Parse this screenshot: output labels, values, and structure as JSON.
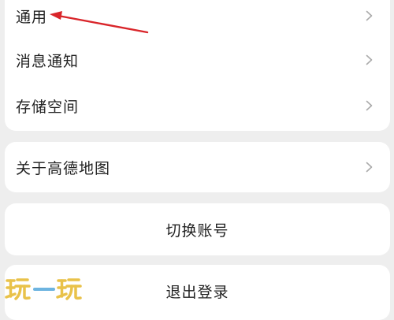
{
  "settings_group_1": {
    "items": [
      {
        "label": "通用"
      },
      {
        "label": "消息通知"
      },
      {
        "label": "存储空间"
      }
    ]
  },
  "settings_group_2": {
    "items": [
      {
        "label": "关于高德地图"
      }
    ]
  },
  "actions": {
    "switch_account": "切换账号",
    "logout": "退出登录"
  },
  "annotation": {
    "arrow_color": "#d9252a"
  },
  "watermark": {
    "text": "玩一玩",
    "colors": [
      "#e9c24a",
      "#6db4e0"
    ]
  },
  "icons": {
    "row_chevron": "chevron-right-icon"
  }
}
